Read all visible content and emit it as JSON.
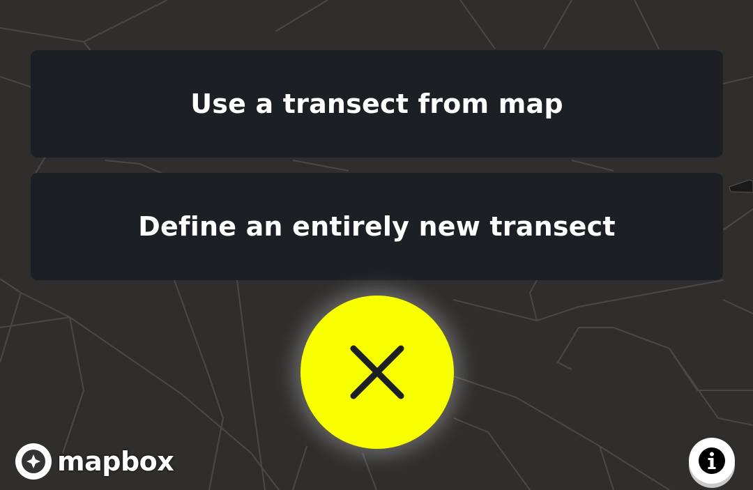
{
  "options": [
    {
      "label": "Use a transect from map"
    },
    {
      "label": "Define an entirely new transect"
    }
  ],
  "close_button": {
    "icon": "close-icon",
    "color": "#f7ff00"
  },
  "attribution": {
    "logo_text": "mapbox",
    "icon": "mapbox-logo-icon"
  },
  "info_button": {
    "icon": "info-icon"
  },
  "colors": {
    "map_background": "#2f2e2d",
    "option_background": "#1c1f24",
    "accent": "#f7ff00"
  }
}
